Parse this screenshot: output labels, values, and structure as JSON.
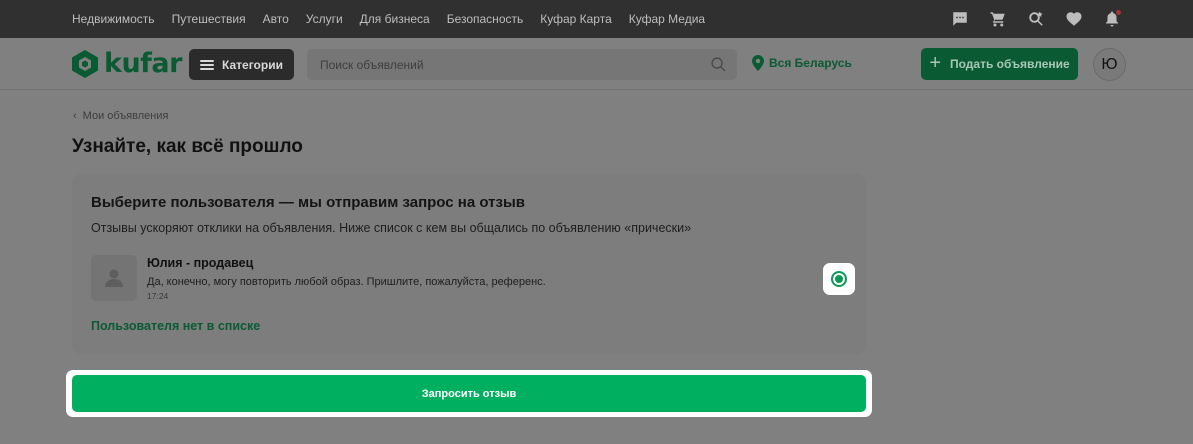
{
  "topbar": {
    "links": [
      "Недвижимость",
      "Путешествия",
      "Авто",
      "Услуги",
      "Для бизнеса",
      "Безопасность",
      "Куфар Карта",
      "Куфар Медиа"
    ],
    "icons": [
      "chat-icon",
      "cart-icon",
      "saved-search-icon",
      "heart-icon",
      "bell-icon"
    ]
  },
  "header": {
    "logo_text": "kufar",
    "categories_label": "Категории",
    "search_placeholder": "Поиск объявлений",
    "region_label": "Вся Беларусь",
    "post_button_label": "Подать объявление",
    "avatar_letter": "Ю"
  },
  "main": {
    "breadcrumb_label": "Мои объявления",
    "page_title": "Узнайте, как всё прошло",
    "card": {
      "title": "Выберите пользователя — мы отправим запрос на отзыв",
      "subtitle": "Отзывы ускоряют отклики на объявления. Ниже список с кем вы общались по объявлению «прически»",
      "users": [
        {
          "name": "Юлия - продавец",
          "message": "Да, конечно, могу повторить любой образ. Пришлите, пожалуйста, референс.",
          "time": "17:24",
          "selected": true
        }
      ],
      "not_in_list_label": "Пользователя нет в списке"
    },
    "submit_label": "Запросить отзыв"
  },
  "colors": {
    "brand_green": "#00af60",
    "dark_green": "#0a5a33",
    "topbar": "#303030",
    "overlay": "#808080"
  }
}
